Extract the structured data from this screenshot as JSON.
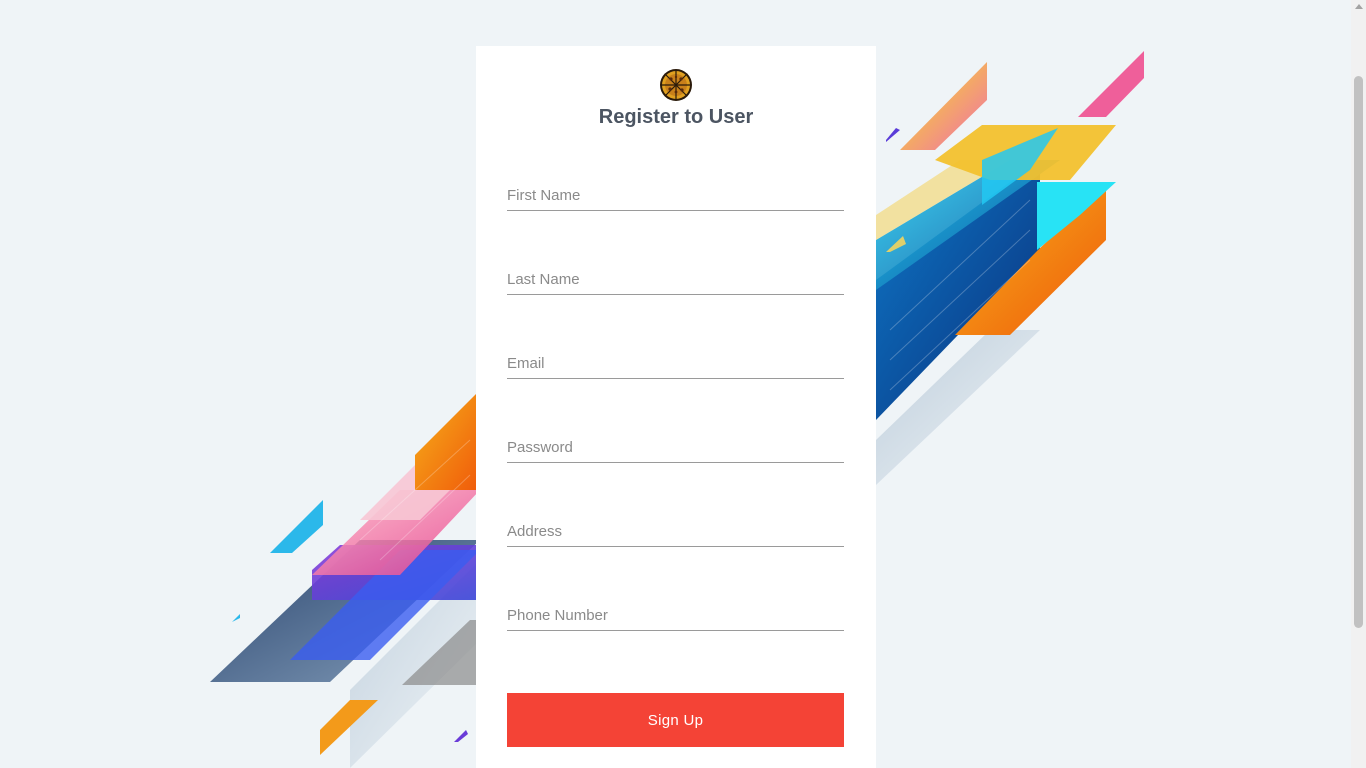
{
  "form": {
    "title": "Register to User",
    "logo_icon": "pizza-icon",
    "fields": [
      {
        "name": "first-name",
        "placeholder": "First Name",
        "value": ""
      },
      {
        "name": "last-name",
        "placeholder": "Last Name",
        "value": ""
      },
      {
        "name": "email",
        "placeholder": "Email",
        "value": ""
      },
      {
        "name": "password",
        "placeholder": "Password",
        "value": ""
      },
      {
        "name": "address",
        "placeholder": "Address",
        "value": ""
      },
      {
        "name": "phone-number",
        "placeholder": "Phone Number",
        "value": ""
      }
    ],
    "submit_label": "Sign Up"
  },
  "colors": {
    "page_background": "#eff4f7",
    "card_background": "#ffffff",
    "button": "#f44336",
    "title": "#4c5562"
  }
}
